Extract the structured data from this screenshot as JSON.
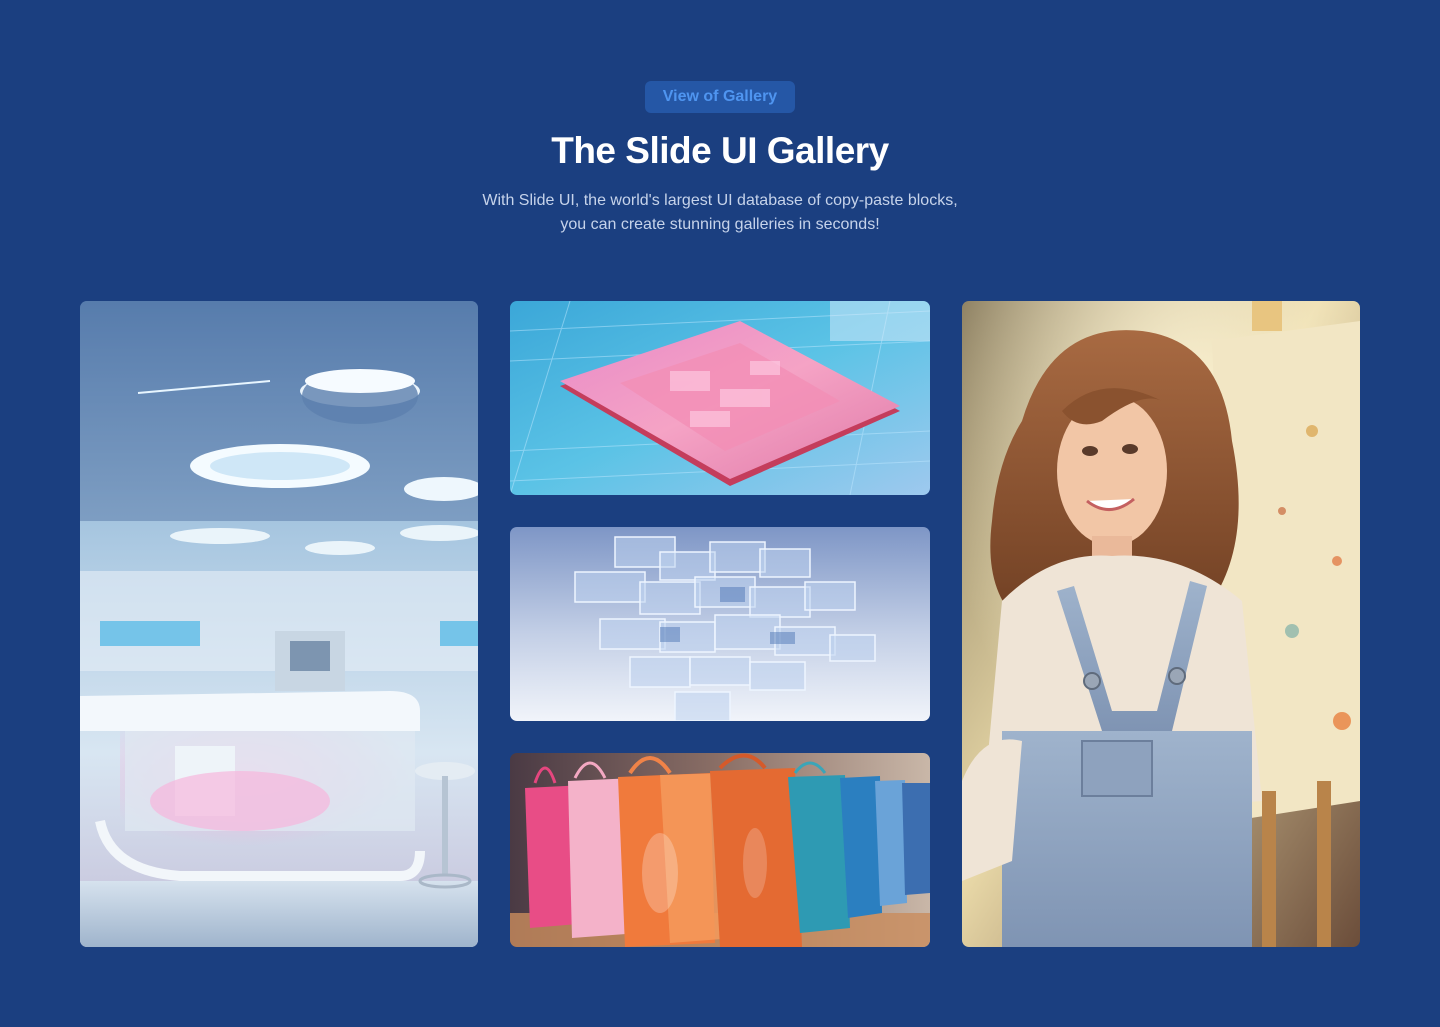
{
  "hero": {
    "badge": "View of Gallery",
    "title": "The Slide UI Gallery",
    "subtitle_line1": "With Slide UI, the world's largest UI database of copy-paste blocks,",
    "subtitle_line2": "you can create stunning galleries in seconds!"
  },
  "gallery": {
    "images": [
      {
        "name": "futuristic-laboratory-image",
        "alt": "Futuristic laboratory"
      },
      {
        "name": "microchip-image",
        "alt": "Microchip"
      },
      {
        "name": "glass-cubes-image",
        "alt": "Glass cubes"
      },
      {
        "name": "shopping-bags-image",
        "alt": "Shopping bags"
      },
      {
        "name": "artist-portrait-image",
        "alt": "Artist portrait"
      }
    ]
  },
  "colors": {
    "background": "#1b3f80",
    "badge_background": "#2557a6",
    "badge_text": "#4f95f0",
    "title": "#ffffff",
    "subtitle": "#c6d3ea"
  }
}
